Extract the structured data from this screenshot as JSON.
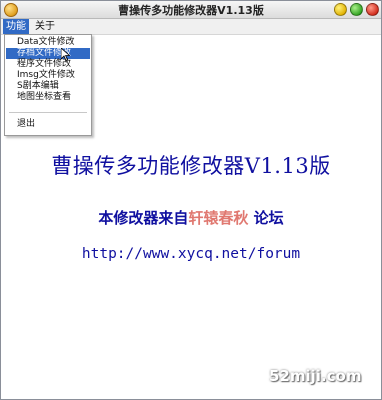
{
  "window": {
    "title": "曹操传多功能修改器V1.13版"
  },
  "menubar": {
    "items": [
      {
        "label": "功能"
      },
      {
        "label": "关于"
      }
    ]
  },
  "dropdown": {
    "items": [
      {
        "label": "Data文件修改"
      },
      {
        "label": "存档文件修改",
        "selected": true
      },
      {
        "label": "程序文件修改"
      },
      {
        "label": "Imsg文件修改"
      },
      {
        "label": "S剧本编辑"
      },
      {
        "label": "地图坐标查看"
      },
      {
        "label": "退出"
      }
    ]
  },
  "main": {
    "title": "曹操传多功能修改器V1.13版",
    "forum_prefix": "本修改器来自",
    "forum_brand": "轩辕春秋",
    "forum_suffix": "论坛",
    "url": "http://www.xycq.net/forum"
  },
  "watermark": "52miji.com",
  "colors": {
    "text_blue": "#1010a0",
    "brand_red": "#e07870",
    "menu_highlight": "#316ac5"
  },
  "icons": {
    "app": "app-icon",
    "cursor": "mouse-cursor-icon"
  }
}
